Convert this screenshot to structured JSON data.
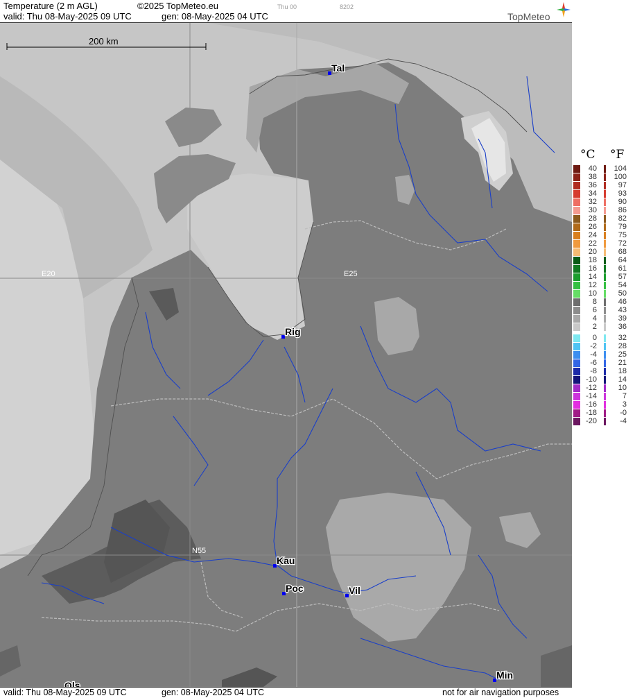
{
  "header": {
    "title": "Temperature (2 m AGL)",
    "copyright": "©2025 TopMeteo.eu",
    "run_tag": "Thu 00",
    "code": "8202",
    "valid": "valid:  Thu  08-May-2025  09 UTC",
    "generated": "gen: 08-May-2025 04 UTC",
    "brand": "TopMeteo"
  },
  "footer": {
    "valid": "valid:  Thu  08-May-2025  09 UTC",
    "generated": "gen: 08-May-2025 04 UTC",
    "disclaimer": "not for air navigation purposes"
  },
  "map": {
    "scale_label": "200 km",
    "grid_labels": {
      "e20": "E20",
      "e25": "E25",
      "n55": "N55"
    },
    "cities": [
      {
        "name": "Tal"
      },
      {
        "name": "Rig"
      },
      {
        "name": "Kau"
      },
      {
        "name": "Poc"
      },
      {
        "name": "Vil"
      },
      {
        "name": "Min"
      },
      {
        "name": "Ols"
      }
    ]
  },
  "legend": {
    "celsius_unit": "°C",
    "fahrenheit_unit": "°F",
    "celsius": [
      "40",
      "38",
      "36",
      "34",
      "32",
      "30",
      "28",
      "26",
      "24",
      "22",
      "20",
      "18",
      "16",
      "14",
      "12",
      "10",
      "8",
      "6",
      "4",
      "2",
      "0",
      "-2",
      "-4",
      "-6",
      "-8",
      "-10",
      "-12",
      "-14",
      "-16",
      "-18",
      "-20"
    ],
    "fahrenheit": [
      "104",
      "100",
      "97",
      "93",
      "90",
      "86",
      "82",
      "79",
      "75",
      "72",
      "68",
      "64",
      "61",
      "57",
      "54",
      "50",
      "46",
      "43",
      "39",
      "36",
      "32",
      "28",
      "25",
      "21",
      "18",
      "14",
      "10",
      "7",
      "3",
      "-0",
      "-4"
    ],
    "colors": [
      "#6e1a12",
      "#8b2218",
      "#b02b20",
      "#d63c30",
      "#ee6f64",
      "#f49a90",
      "#8c5a1e",
      "#b06a1a",
      "#d97f1e",
      "#f09a3e",
      "#f6bb74",
      "#0a5a16",
      "#127a22",
      "#1c9e2e",
      "#34c042",
      "#66dd66",
      "#6e6e6e",
      "#8c8c8c",
      "#a8a8a8",
      "#c8c8c8",
      "#7ee8f0",
      "#4fc3f3",
      "#3c8ef0",
      "#3366e6",
      "#1c2aa8",
      "#14147a",
      "#a22ac8",
      "#cc33dd",
      "#e22de0",
      "#a01b86",
      "#6b1760"
    ]
  }
}
